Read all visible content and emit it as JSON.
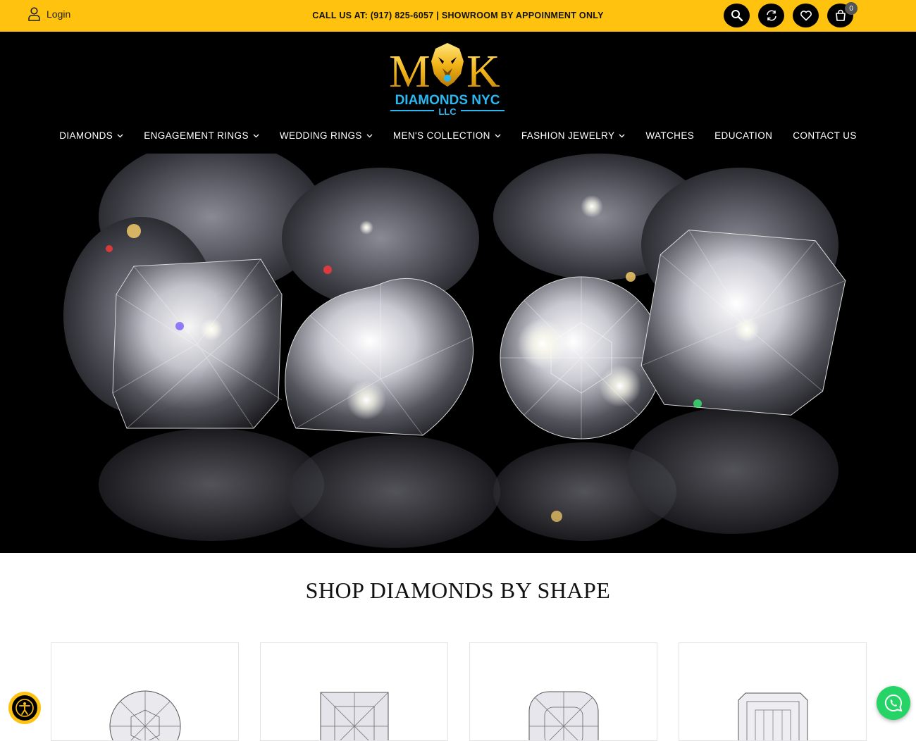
{
  "topbar": {
    "login_label": "Login",
    "phone_text": "CALL US AT: (917) 825-6057 | SHOWROOM BY APPOINMENT ONLY",
    "cart_count": "0",
    "icons": [
      "search-icon",
      "compare-icon",
      "heart-icon",
      "cart-icon"
    ]
  },
  "brand": {
    "logo_letters": "MK",
    "logo_line1": "DIAMONDS NYC",
    "logo_line2": "LLC",
    "accent_color": "#ffc20e",
    "logo_blue": "#2bb8f0"
  },
  "nav": {
    "items": [
      {
        "label": "DIAMONDS",
        "has_dropdown": true
      },
      {
        "label": "ENGAGEMENT RINGS",
        "has_dropdown": true
      },
      {
        "label": "WEDDING RINGS",
        "has_dropdown": true
      },
      {
        "label": "MEN'S COLLECTION",
        "has_dropdown": true
      },
      {
        "label": "FASHION JEWELRY",
        "has_dropdown": true
      },
      {
        "label": "WATCHES",
        "has_dropdown": false
      },
      {
        "label": "EDUCATION",
        "has_dropdown": false
      },
      {
        "label": "CONTACT US",
        "has_dropdown": false
      }
    ]
  },
  "shapes": {
    "title": "SHOP DIAMONDS BY SHAPE",
    "cards": [
      "round",
      "princess",
      "cushion",
      "emerald"
    ]
  }
}
